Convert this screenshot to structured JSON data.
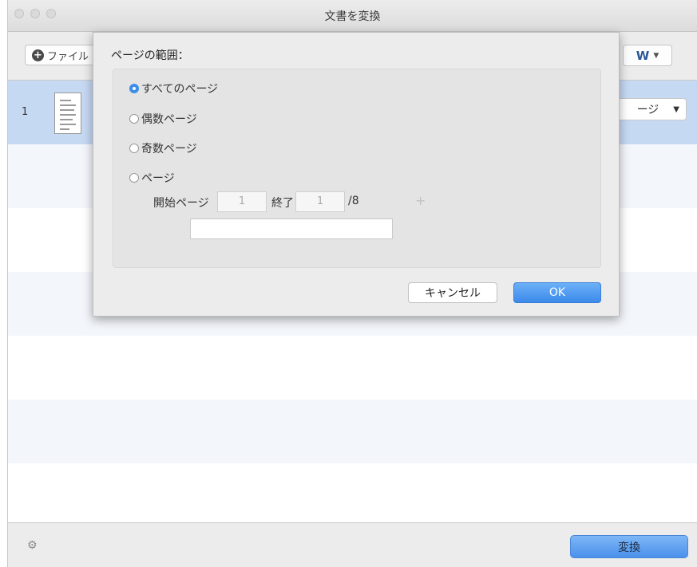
{
  "window": {
    "title": "文書を変換"
  },
  "toolbar": {
    "add_file_label": "ファイル",
    "format_label": "W"
  },
  "file_list": {
    "rows": [
      {
        "index": "1",
        "page_select_value": "ージ"
      }
    ]
  },
  "dialog": {
    "title": "ページの範囲：",
    "options": [
      {
        "label": "すべてのページ",
        "selected": true
      },
      {
        "label": "偶数ページ",
        "selected": false
      },
      {
        "label": "奇数ページ",
        "selected": false
      },
      {
        "label": "ページ",
        "selected": false
      }
    ],
    "start_label": "開始ページ",
    "start_value": "1",
    "end_label": "終了",
    "end_value": "1",
    "total_label": "/8",
    "add_label": "+",
    "cancel_label": "キャンセル",
    "ok_label": "OK"
  },
  "bottombar": {
    "convert_label": "変換"
  },
  "colors": {
    "accent": "#3d8ee9",
    "selected_row": "#c6d9f3",
    "alt_row": "#f3f6fb"
  },
  "icons": [
    "add-circle-icon",
    "word-format-icon",
    "document-thumbnail-icon",
    "gear-icon",
    "chevron-down-icon"
  ]
}
